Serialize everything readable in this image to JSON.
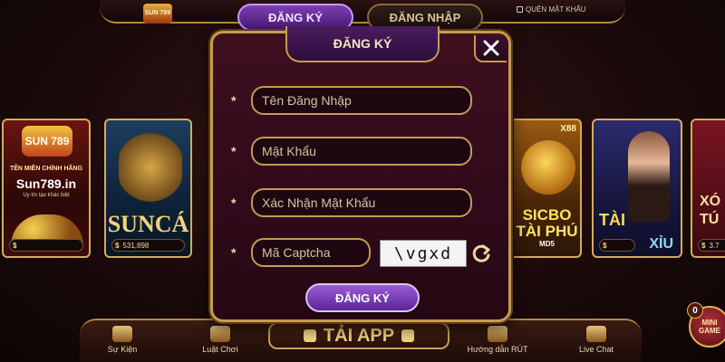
{
  "topbar": {
    "logo_text": "SUN 789",
    "tab_register": "ĐĂNG KÝ",
    "tab_login": "ĐĂNG NHẬP",
    "forgot_password": "QUÊN MẬT KHẨU"
  },
  "cards": {
    "sun": {
      "brand": "SUN 789",
      "line1": "TÊN MIỀN CHÍNH HÃNG",
      "line2": "Sun789.in",
      "line3": "Uy tín tạo khác biệt",
      "currency": "$"
    },
    "ca": {
      "title": "SUNCÁ",
      "currency": "$",
      "jackpot": "531,898"
    },
    "sicbo": {
      "badge": "X88",
      "title": "SICBO\nTÀI PHÚ",
      "sub": "MD5"
    },
    "taixiu": {
      "tai": "TÀI",
      "xiu": "XỈU",
      "currency": "$"
    },
    "xo": {
      "title": "XÓ\nTÚ",
      "currency": "$",
      "jackpot": "3.7"
    }
  },
  "modal": {
    "title": "ĐĂNG KÝ",
    "required_mark": "*",
    "fields": {
      "username_placeholder": "Tên Đăng Nhập",
      "password_placeholder": "Mật Khẩu",
      "confirm_placeholder": "Xác Nhận Mật Khẩu",
      "captcha_placeholder": "Mã Captcha"
    },
    "captcha_text": "\\vgxd",
    "submit_label": "ĐĂNG KÝ"
  },
  "bottombar": {
    "events": "Sự Kiện",
    "rules": "Luật Chơi",
    "app": "TẢI APP",
    "withdraw_guide": "Hướng dẫn RÚT",
    "live_chat": "Live Chat",
    "mini_game": "MINI\nGAME",
    "mini_count": "0"
  },
  "colors": {
    "accent_gold": "#c89b4e",
    "purple_button": "#7c3fb0",
    "modal_bg": "#3e0f1f"
  }
}
